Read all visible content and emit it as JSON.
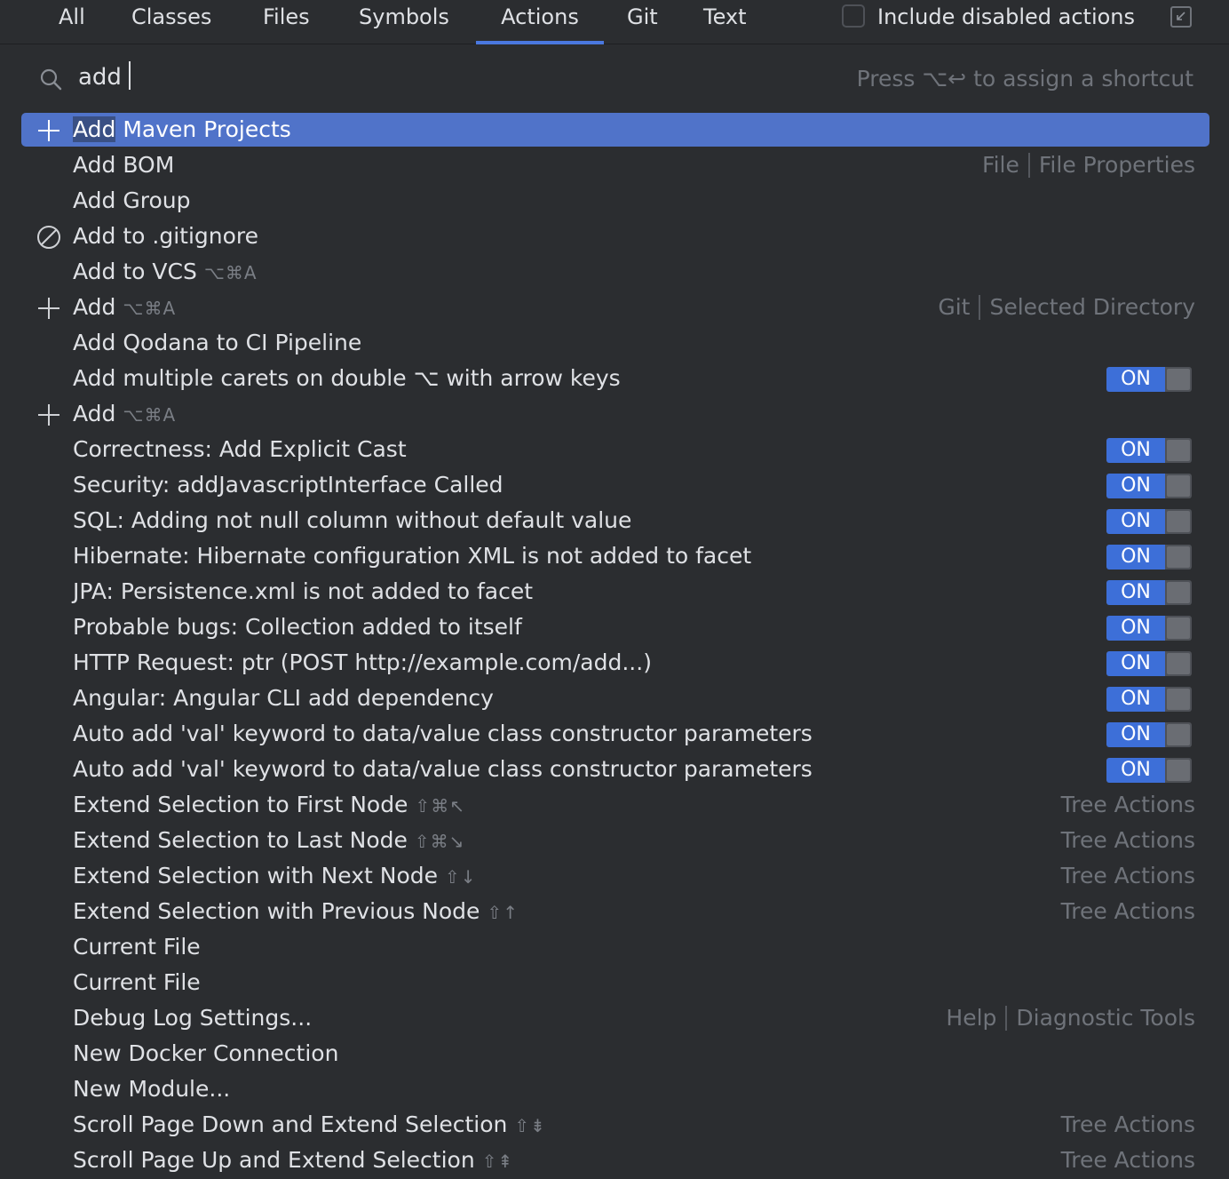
{
  "tabs": [
    "All",
    "Classes",
    "Files",
    "Symbols",
    "Actions",
    "Git",
    "Text"
  ],
  "active_tab": "Actions",
  "include_disabled_label": "Include disabled actions",
  "search": {
    "query": "add",
    "hint": "Press ⌥↩ to assign a shortcut"
  },
  "results": [
    {
      "icon": "plus-icon",
      "pre": "",
      "hl": "Add",
      "post": " Maven Projects",
      "shortcut": "",
      "right_a": "",
      "right_b": "",
      "toggle": "",
      "selected": true
    },
    {
      "icon": "",
      "pre": "Add BOM",
      "hl": "",
      "post": "",
      "shortcut": "",
      "right_a": "File",
      "right_b": "File Properties",
      "toggle": "",
      "selected": false
    },
    {
      "icon": "",
      "pre": "Add Group",
      "hl": "",
      "post": "",
      "shortcut": "",
      "right_a": "",
      "right_b": "",
      "toggle": "",
      "selected": false
    },
    {
      "icon": "ignore-icon",
      "pre": "Add to .gitignore",
      "hl": "",
      "post": "",
      "shortcut": "",
      "right_a": "",
      "right_b": "",
      "toggle": "",
      "selected": false
    },
    {
      "icon": "",
      "pre": "Add to VCS",
      "hl": "",
      "post": "",
      "shortcut": "⌥⌘A",
      "right_a": "",
      "right_b": "",
      "toggle": "",
      "selected": false
    },
    {
      "icon": "plus-icon",
      "pre": "Add",
      "hl": "",
      "post": "",
      "shortcut": "⌥⌘A",
      "right_a": "Git",
      "right_b": "Selected Directory",
      "toggle": "",
      "selected": false
    },
    {
      "icon": "",
      "pre": "Add Qodana to CI Pipeline",
      "hl": "",
      "post": "",
      "shortcut": "",
      "right_a": "",
      "right_b": "",
      "toggle": "",
      "selected": false
    },
    {
      "icon": "",
      "pre": "Add multiple carets on double ⌥ with arrow keys",
      "hl": "",
      "post": "",
      "shortcut": "",
      "right_a": "",
      "right_b": "",
      "toggle": "ON",
      "selected": false
    },
    {
      "icon": "plus-icon",
      "pre": "Add",
      "hl": "",
      "post": "",
      "shortcut": "⌥⌘A",
      "right_a": "",
      "right_b": "",
      "toggle": "",
      "selected": false
    },
    {
      "icon": "",
      "pre": "Correctness: Add Explicit Cast",
      "hl": "",
      "post": "",
      "shortcut": "",
      "right_a": "",
      "right_b": "",
      "toggle": "ON",
      "selected": false
    },
    {
      "icon": "",
      "pre": "Security: addJavascriptInterface Called",
      "hl": "",
      "post": "",
      "shortcut": "",
      "right_a": "",
      "right_b": "",
      "toggle": "ON",
      "selected": false
    },
    {
      "icon": "",
      "pre": "SQL: Adding not null column without default value",
      "hl": "",
      "post": "",
      "shortcut": "",
      "right_a": "",
      "right_b": "",
      "toggle": "ON",
      "selected": false
    },
    {
      "icon": "",
      "pre": "Hibernate: Hibernate configuration XML is not added to facet",
      "hl": "",
      "post": "",
      "shortcut": "",
      "right_a": "",
      "right_b": "",
      "toggle": "ON",
      "selected": false
    },
    {
      "icon": "",
      "pre": "JPA: Persistence.xml is not added to facet",
      "hl": "",
      "post": "",
      "shortcut": "",
      "right_a": "",
      "right_b": "",
      "toggle": "ON",
      "selected": false
    },
    {
      "icon": "",
      "pre": "Probable bugs: Collection added to itself",
      "hl": "",
      "post": "",
      "shortcut": "",
      "right_a": "",
      "right_b": "",
      "toggle": "ON",
      "selected": false
    },
    {
      "icon": "",
      "pre": "HTTP Request: ptr (POST http://example.com/add...)",
      "hl": "",
      "post": "",
      "shortcut": "",
      "right_a": "",
      "right_b": "",
      "toggle": "ON",
      "selected": false
    },
    {
      "icon": "",
      "pre": "Angular: Angular CLI add dependency",
      "hl": "",
      "post": "",
      "shortcut": "",
      "right_a": "",
      "right_b": "",
      "toggle": "ON",
      "selected": false
    },
    {
      "icon": "",
      "pre": "Auto add 'val' keyword to data/value class constructor parameters",
      "hl": "",
      "post": "",
      "shortcut": "",
      "right_a": "",
      "right_b": "",
      "toggle": "ON",
      "selected": false
    },
    {
      "icon": "",
      "pre": "Auto add 'val' keyword to data/value class constructor parameters",
      "hl": "",
      "post": "",
      "shortcut": "",
      "right_a": "",
      "right_b": "",
      "toggle": "ON",
      "selected": false
    },
    {
      "icon": "",
      "pre": "Extend Selection to First Node",
      "hl": "",
      "post": "",
      "shortcut": "⇧⌘↖",
      "right_a": "Tree Actions",
      "right_b": "",
      "toggle": "",
      "selected": false
    },
    {
      "icon": "",
      "pre": "Extend Selection to Last Node",
      "hl": "",
      "post": "",
      "shortcut": "⇧⌘↘",
      "right_a": "Tree Actions",
      "right_b": "",
      "toggle": "",
      "selected": false
    },
    {
      "icon": "",
      "pre": "Extend Selection with Next Node",
      "hl": "",
      "post": "",
      "shortcut": "⇧↓",
      "right_a": "Tree Actions",
      "right_b": "",
      "toggle": "",
      "selected": false
    },
    {
      "icon": "",
      "pre": "Extend Selection with Previous Node",
      "hl": "",
      "post": "",
      "shortcut": "⇧↑",
      "right_a": "Tree Actions",
      "right_b": "",
      "toggle": "",
      "selected": false
    },
    {
      "icon": "",
      "pre": "Current File",
      "hl": "",
      "post": "",
      "shortcut": "",
      "right_a": "",
      "right_b": "",
      "toggle": "",
      "selected": false
    },
    {
      "icon": "",
      "pre": "Current File",
      "hl": "",
      "post": "",
      "shortcut": "",
      "right_a": "",
      "right_b": "",
      "toggle": "",
      "selected": false
    },
    {
      "icon": "",
      "pre": "Debug Log Settings...",
      "hl": "",
      "post": "",
      "shortcut": "",
      "right_a": "Help",
      "right_b": "Diagnostic Tools",
      "toggle": "",
      "selected": false
    },
    {
      "icon": "",
      "pre": "New Docker Connection",
      "hl": "",
      "post": "",
      "shortcut": "",
      "right_a": "",
      "right_b": "",
      "toggle": "",
      "selected": false
    },
    {
      "icon": "",
      "pre": "New Module...",
      "hl": "",
      "post": "",
      "shortcut": "",
      "right_a": "",
      "right_b": "",
      "toggle": "",
      "selected": false
    },
    {
      "icon": "",
      "pre": "Scroll Page Down and Extend Selection",
      "hl": "",
      "post": "",
      "shortcut": "⇧⇟",
      "right_a": "Tree Actions",
      "right_b": "",
      "toggle": "",
      "selected": false
    },
    {
      "icon": "",
      "pre": "Scroll Page Up and Extend Selection",
      "hl": "",
      "post": "",
      "shortcut": "⇧⇞",
      "right_a": "Tree Actions",
      "right_b": "",
      "toggle": "",
      "selected": false
    }
  ]
}
